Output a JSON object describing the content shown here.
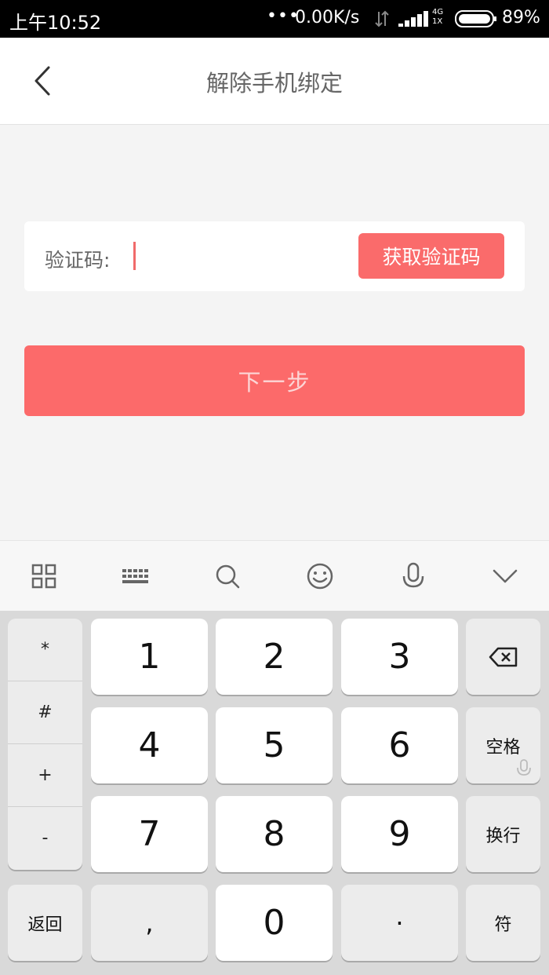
{
  "status_bar": {
    "time": "上午10:52",
    "dots": "•••",
    "speed": "0.00K/s",
    "net_top": "4G",
    "net_bottom": "1X",
    "battery": "89%"
  },
  "nav": {
    "title": "解除手机绑定",
    "back_icon": "chevron-left-icon"
  },
  "form": {
    "code_label": "验证码:",
    "code_value": "",
    "get_code_button": "获取验证码",
    "next_button": "下一步"
  },
  "colors": {
    "accent": "#fa6b6b",
    "next_text": "#fcd6d6"
  },
  "keyboard_toolbar": {
    "icons": [
      "grid-icon",
      "keyboard-icon",
      "search-icon",
      "emoji-icon",
      "mic-icon",
      "chevron-down-icon"
    ]
  },
  "keyboard": {
    "symbols": [
      "*",
      "#",
      "+",
      "-"
    ],
    "digits": [
      "1",
      "2",
      "3",
      "4",
      "5",
      "6",
      "7",
      "8",
      "9"
    ],
    "backspace_icon": "backspace-icon",
    "space": "空格",
    "enter": "换行",
    "back": "返回",
    "comma": ",",
    "zero": "0",
    "dot": "·",
    "symbol_key": "符"
  }
}
